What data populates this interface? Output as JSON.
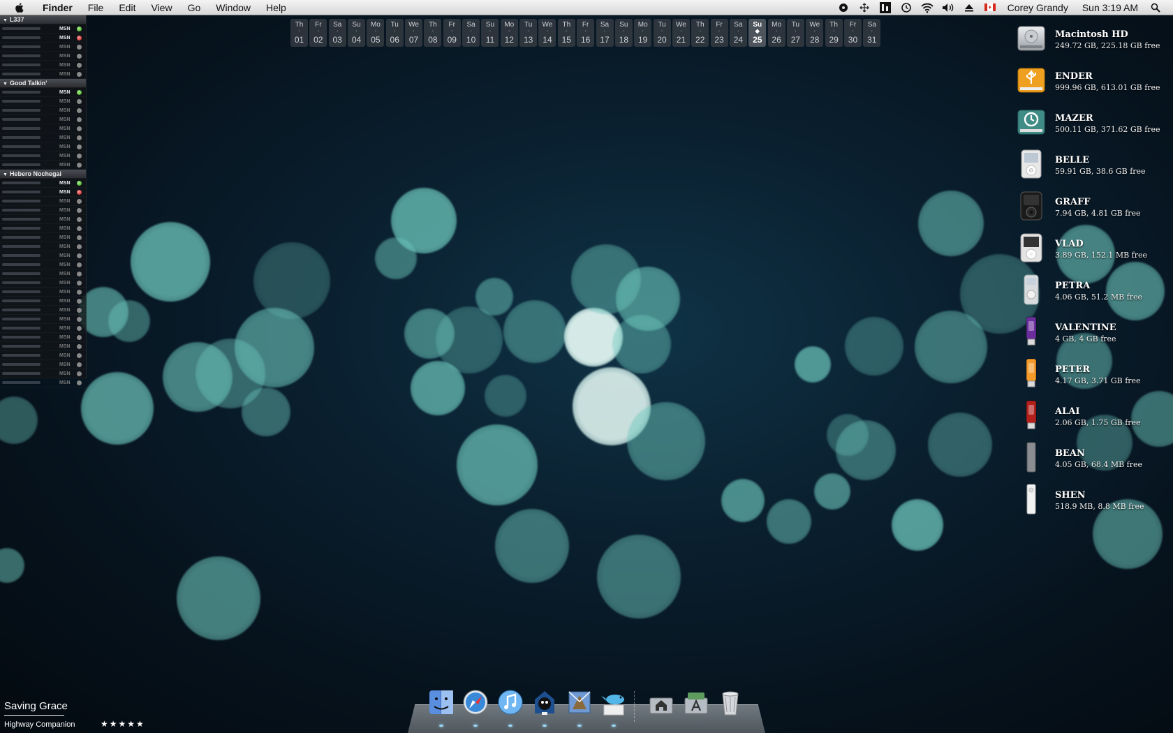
{
  "menubar": {
    "app_name": "Finder",
    "menus": [
      "File",
      "Edit",
      "View",
      "Go",
      "Window",
      "Help"
    ],
    "status_icons": [
      "radio-icon",
      "spaces-icon",
      "menu-meters-icon",
      "time-machine-icon",
      "wifi-icon",
      "volume-icon",
      "eject-icon",
      "canada-flag-icon"
    ],
    "user": "Corey Grandy",
    "clock": "Sun 3:19 AM"
  },
  "buddy_list": {
    "groups": [
      {
        "name": "L337",
        "rows": [
          {
            "service": "MSN",
            "status": "green"
          },
          {
            "service": "MSN",
            "status": "red"
          },
          {
            "service": "MSN",
            "status": "grey"
          },
          {
            "service": "MSN",
            "status": "grey"
          },
          {
            "service": "MSN",
            "status": "grey"
          },
          {
            "service": "MSN",
            "status": "grey"
          }
        ]
      },
      {
        "name": "Good Talkin'",
        "rows": [
          {
            "service": "MSN",
            "status": "green"
          },
          {
            "service": "MSN",
            "status": "grey"
          },
          {
            "service": "MSN",
            "status": "grey"
          },
          {
            "service": "MSN",
            "status": "grey"
          },
          {
            "service": "MSN",
            "status": "grey"
          },
          {
            "service": "MSN",
            "status": "grey"
          },
          {
            "service": "MSN",
            "status": "grey"
          },
          {
            "service": "MSN",
            "status": "grey"
          },
          {
            "service": "MSN",
            "status": "grey"
          }
        ]
      },
      {
        "name": "Hebero Nochegai",
        "rows": [
          {
            "service": "MSN",
            "status": "green"
          },
          {
            "service": "MSN",
            "status": "red"
          },
          {
            "service": "MSN",
            "status": "grey"
          },
          {
            "service": "MSN",
            "status": "grey"
          },
          {
            "service": "MSN",
            "status": "grey"
          },
          {
            "service": "MSN",
            "status": "grey"
          },
          {
            "service": "MSN",
            "status": "grey"
          },
          {
            "service": "MSN",
            "status": "grey"
          },
          {
            "service": "MSN",
            "status": "grey"
          },
          {
            "service": "MSN",
            "status": "grey"
          },
          {
            "service": "MSN",
            "status": "grey"
          },
          {
            "service": "MSN",
            "status": "grey"
          },
          {
            "service": "MSN",
            "status": "grey"
          },
          {
            "service": "MSN",
            "status": "grey"
          },
          {
            "service": "MSN",
            "status": "grey"
          },
          {
            "service": "MSN",
            "status": "grey"
          },
          {
            "service": "MSN",
            "status": "grey"
          },
          {
            "service": "MSN",
            "status": "grey"
          },
          {
            "service": "MSN",
            "status": "grey"
          },
          {
            "service": "MSN",
            "status": "grey"
          },
          {
            "service": "MSN",
            "status": "grey"
          },
          {
            "service": "MSN",
            "status": "grey"
          },
          {
            "service": "MSN",
            "status": "grey"
          }
        ]
      }
    ]
  },
  "calendar": {
    "today": "25",
    "days": [
      {
        "name": "Th",
        "date": "01"
      },
      {
        "name": "Fr",
        "date": "02"
      },
      {
        "name": "Sa",
        "date": "03"
      },
      {
        "name": "Su",
        "date": "04"
      },
      {
        "name": "Mo",
        "date": "05"
      },
      {
        "name": "Tu",
        "date": "06"
      },
      {
        "name": "We",
        "date": "07"
      },
      {
        "name": "Th",
        "date": "08"
      },
      {
        "name": "Fr",
        "date": "09"
      },
      {
        "name": "Sa",
        "date": "10"
      },
      {
        "name": "Su",
        "date": "11"
      },
      {
        "name": "Mo",
        "date": "12"
      },
      {
        "name": "Tu",
        "date": "13"
      },
      {
        "name": "We",
        "date": "14"
      },
      {
        "name": "Th",
        "date": "15"
      },
      {
        "name": "Fr",
        "date": "16"
      },
      {
        "name": "Sa",
        "date": "17"
      },
      {
        "name": "Su",
        "date": "18"
      },
      {
        "name": "Mo",
        "date": "19"
      },
      {
        "name": "Tu",
        "date": "20"
      },
      {
        "name": "We",
        "date": "21"
      },
      {
        "name": "Th",
        "date": "22"
      },
      {
        "name": "Fr",
        "date": "23"
      },
      {
        "name": "Sa",
        "date": "24"
      },
      {
        "name": "Su",
        "date": "25"
      },
      {
        "name": "Mo",
        "date": "26"
      },
      {
        "name": "Tu",
        "date": "27"
      },
      {
        "name": "We",
        "date": "28"
      },
      {
        "name": "Th",
        "date": "29"
      },
      {
        "name": "Fr",
        "date": "30"
      },
      {
        "name": "Sa",
        "date": "31"
      }
    ]
  },
  "volumes": [
    {
      "name": "Macintosh HD",
      "info": "249.72 GB, 225.18 GB free",
      "icon": "hard-drive-icon",
      "color": "#b8bcc2"
    },
    {
      "name": "ENDER",
      "info": "999.96 GB, 613.01 GB free",
      "icon": "usb-drive-icon",
      "color": "#f0a020"
    },
    {
      "name": "MAZER",
      "info": "500.11 GB, 371.62 GB free",
      "icon": "time-machine-drive-icon",
      "color": "#3f8c86"
    },
    {
      "name": "BELLE",
      "info": "59.91 GB, 38.6 GB free",
      "icon": "ipod-classic-icon",
      "color": "#e8e8e8"
    },
    {
      "name": "GRAFF",
      "info": "7.94 GB, 4.81 GB free",
      "icon": "ipod-nano-black-icon",
      "color": "#222222"
    },
    {
      "name": "VLAD",
      "info": "3.89 GB, 152.1 MB free",
      "icon": "ipod-nano-white-icon",
      "color": "#e4e4e4"
    },
    {
      "name": "PETRA",
      "info": "4.06 GB, 51.2 MB free",
      "icon": "ipod-mini-icon",
      "color": "#d9dcdf"
    },
    {
      "name": "VALENTINE",
      "info": "4 GB, 4 GB free",
      "icon": "usb-stick-purple-icon",
      "color": "#6a2e9c"
    },
    {
      "name": "PETER",
      "info": "4.17 GB, 3.71 GB free",
      "icon": "usb-stick-orange-icon",
      "color": "#f29a2a"
    },
    {
      "name": "ALAI",
      "info": "2.06 GB, 1.75 GB free",
      "icon": "usb-stick-red-icon",
      "color": "#b3201c"
    },
    {
      "name": "BEAN",
      "info": "4.05 GB, 68.4 MB free",
      "icon": "ipod-shuffle-icon",
      "color": "#8a8d92"
    },
    {
      "name": "SHEN",
      "info": "518.9 MB, 8.8 MB free",
      "icon": "ipod-shuffle-white-icon",
      "color": "#f2f2f2"
    }
  ],
  "dock": {
    "apps": [
      {
        "name": "finder",
        "icon": "finder-icon",
        "running": true
      },
      {
        "name": "safari",
        "icon": "safari-icon",
        "running": true
      },
      {
        "name": "itunes",
        "icon": "itunes-icon",
        "running": true
      },
      {
        "name": "adium",
        "icon": "adium-icon",
        "running": true
      },
      {
        "name": "mail",
        "icon": "mail-icon",
        "running": true
      },
      {
        "name": "twitterrific",
        "icon": "twitter-bird-icon",
        "running": true
      }
    ],
    "stacks": [
      {
        "name": "home",
        "icon": "home-folder-icon"
      },
      {
        "name": "applications",
        "icon": "applications-folder-icon"
      },
      {
        "name": "trash",
        "icon": "trash-icon"
      }
    ]
  },
  "now_playing": {
    "title": "Saving Grace",
    "artist": "Highway Companion",
    "rating": "★★★★★"
  }
}
